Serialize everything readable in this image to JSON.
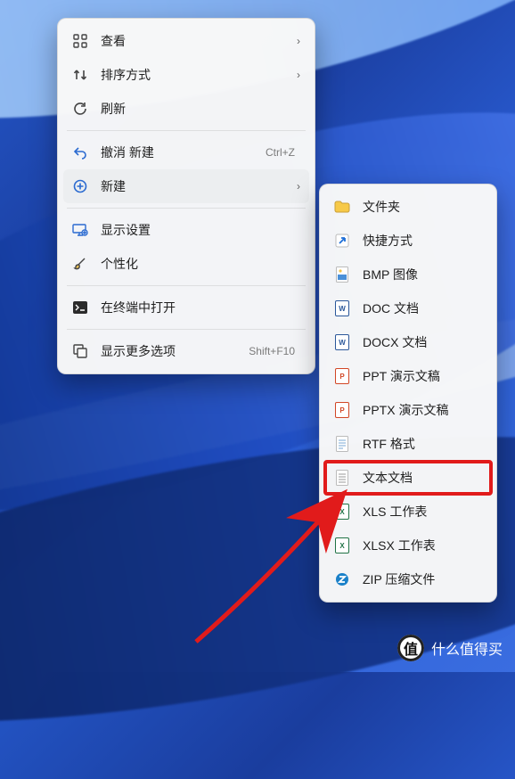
{
  "main_menu": {
    "view": {
      "label": "查看"
    },
    "sort": {
      "label": "排序方式"
    },
    "refresh": {
      "label": "刷新"
    },
    "undo_new": {
      "label": "撤消 新建",
      "shortcut": "Ctrl+Z"
    },
    "new": {
      "label": "新建"
    },
    "display": {
      "label": "显示设置"
    },
    "personalize": {
      "label": "个性化"
    },
    "terminal": {
      "label": "在终端中打开"
    },
    "more": {
      "label": "显示更多选项",
      "shortcut": "Shift+F10"
    }
  },
  "new_submenu": {
    "folder": {
      "label": "文件夹"
    },
    "shortcut": {
      "label": "快捷方式"
    },
    "bmp": {
      "label": "BMP 图像"
    },
    "doc": {
      "label": "DOC 文档"
    },
    "docx": {
      "label": "DOCX 文档"
    },
    "ppt": {
      "label": "PPT 演示文稿"
    },
    "pptx": {
      "label": "PPTX 演示文稿"
    },
    "rtf": {
      "label": "RTF 格式"
    },
    "txt": {
      "label": "文本文档"
    },
    "xls": {
      "label": "XLS 工作表"
    },
    "xlsx": {
      "label": "XLSX 工作表"
    },
    "zip": {
      "label": "ZIP 压缩文件"
    }
  },
  "watermark": {
    "badge": "值",
    "text": "什么值得买"
  },
  "colors": {
    "highlight": "#e11b1b"
  }
}
